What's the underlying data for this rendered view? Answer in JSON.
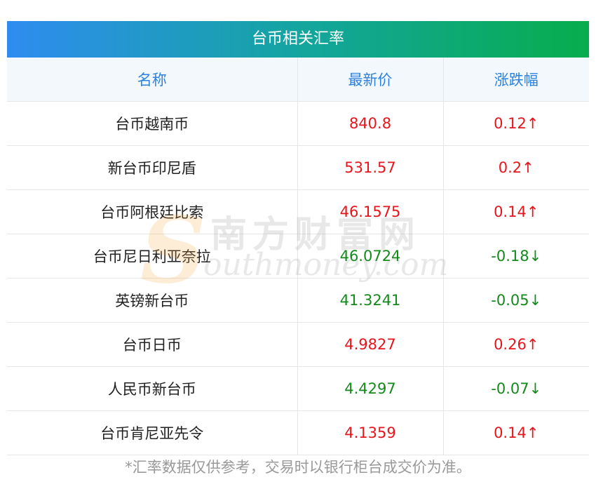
{
  "title": "台币相关汇率",
  "headers": {
    "name": "名称",
    "price": "最新价",
    "change": "涨跌幅"
  },
  "rows": [
    {
      "name": "台币越南币",
      "price": "840.8",
      "change": "0.12↑",
      "direction": "up"
    },
    {
      "name": "新台币印尼盾",
      "price": "531.57",
      "change": "0.2↑",
      "direction": "up"
    },
    {
      "name": "台币阿根廷比索",
      "price": "46.1575",
      "change": "0.14↑",
      "direction": "up"
    },
    {
      "name": "台币尼日利亚奈拉",
      "price": "46.0724",
      "change": "-0.18↓",
      "direction": "down"
    },
    {
      "name": "英镑新台币",
      "price": "41.3241",
      "change": "-0.05↓",
      "direction": "down"
    },
    {
      "name": "台币日币",
      "price": "4.9827",
      "change": "0.26↑",
      "direction": "up"
    },
    {
      "name": "人民币新台币",
      "price": "4.4297",
      "change": "-0.07↓",
      "direction": "down"
    },
    {
      "name": "台币肯尼亚先令",
      "price": "4.1359",
      "change": "0.14↑",
      "direction": "up"
    }
  ],
  "footnote": "*汇率数据仅供参考，交易时以银行柜台成交价为准。",
  "watermark": {
    "letter": "S",
    "chinese": "南方财富网",
    "english": "outhmoney.com"
  },
  "colors": {
    "up": "#e8141c",
    "down": "#138a1a",
    "header_text": "#2c82e0",
    "header_bg": "#f3f8fd"
  }
}
